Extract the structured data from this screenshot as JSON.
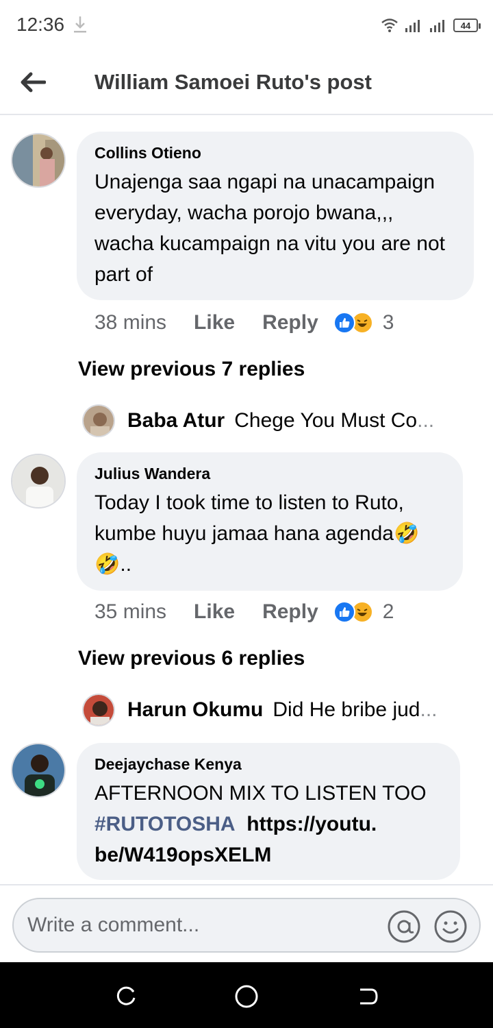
{
  "status_bar": {
    "time": "12:36",
    "battery": "44"
  },
  "header": {
    "title": "William Samoei Ruto's post"
  },
  "comments": [
    {
      "author": "Collins Otieno",
      "text": "Unajenga saa ngapi na unacampaign everyday, wacha porojo bwana,,, wacha kucampaign na vitu you are not part of",
      "time": "38 mins",
      "like_label": "Like",
      "reply_label": "Reply",
      "reaction_count": "3",
      "view_previous": "View previous 7 replies",
      "latest_reply": {
        "author": "Baba Atur",
        "text": "Chege You Must Co",
        "ellipsis": "..."
      }
    },
    {
      "author": "Julius Wandera",
      "text": "Today I took time to listen to Ruto, kumbe huyu jamaa hana agenda",
      "emoji_suffix": "🤣🤣..",
      "time": "35 mins",
      "like_label": "Like",
      "reply_label": "Reply",
      "reaction_count": "2",
      "view_previous": "View previous 6 replies",
      "latest_reply": {
        "author": "Harun Okumu",
        "text": "Did He bribe jud",
        "ellipsis": "..."
      }
    },
    {
      "author": "Deejaychase Kenya",
      "text_line1": "AFTERNOON MIX TO LISTEN TOO",
      "hashtag": "#RUTOTOSHA",
      "link_part1": "https://youtu.",
      "link_part2": "be/W419opsXELM"
    }
  ],
  "composer": {
    "placeholder": "Write a comment..."
  },
  "icons": {
    "back": "back-arrow-icon",
    "mention": "at-sign-icon",
    "emoji": "smiley-icon",
    "like_reaction": "like-reaction-icon",
    "haha_reaction": "haha-reaction-icon"
  },
  "colors": {
    "like_blue": "#1877f2",
    "haha_yellow": "#f7b125",
    "bubble_bg": "#f0f2f5",
    "hashtag": "#4b5e86"
  }
}
